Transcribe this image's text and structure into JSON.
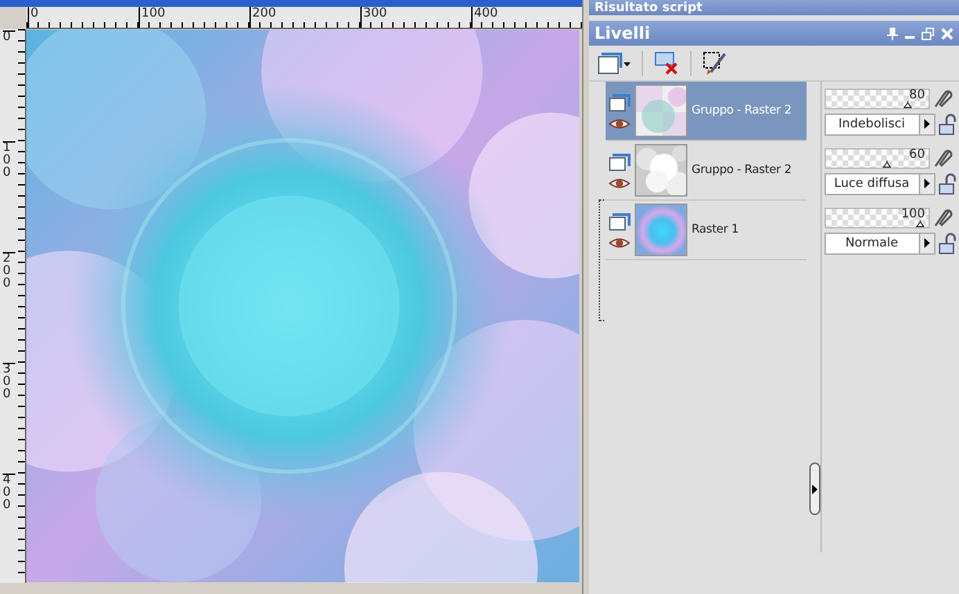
{
  "rulers": {
    "horizontal_labels": [
      "0",
      "100",
      "200",
      "300",
      "400"
    ],
    "vertical_labels": [
      "0",
      "100",
      "200",
      "300",
      "400"
    ]
  },
  "script_panel": {
    "title": "Risultato script"
  },
  "layers_panel": {
    "title": "Livelli",
    "layers": [
      {
        "name": "Gruppo - Raster 2",
        "selected": true,
        "kind": "faded",
        "opacity": "80",
        "level": 0.8,
        "blend_mode": "Indebolisci"
      },
      {
        "name": "Gruppo - Raster 2",
        "selected": false,
        "kind": "bokeh",
        "opacity": "60",
        "level": 0.6,
        "blend_mode": "Luce diffusa"
      },
      {
        "name": "Raster 1",
        "selected": false,
        "kind": "radial",
        "opacity": "100",
        "level": 1.0,
        "blend_mode": "Normale"
      }
    ]
  }
}
